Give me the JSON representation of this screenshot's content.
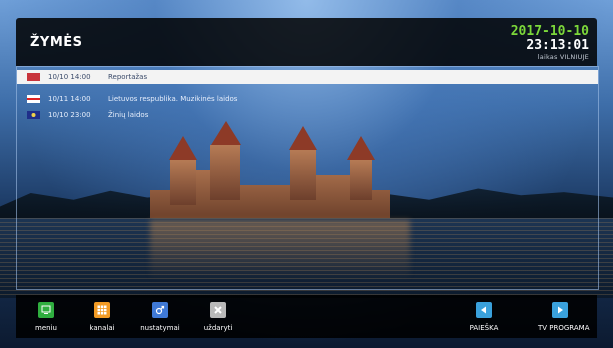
{
  "header": {
    "title": "ŽYMĖS"
  },
  "clock": {
    "date": "2017-10-10",
    "time": "23:13:01",
    "timezone": "laikas VILNIUJE"
  },
  "reminders": [
    {
      "flag": "flag-icon",
      "datetime": "10/10 14:00",
      "name": "Reportažas",
      "selected": true
    },
    {
      "flag": "flag-icon",
      "datetime": "10/11 14:00",
      "name": "Lietuvos respublika. Muzikinės laidos",
      "selected": false
    },
    {
      "flag": "flag-icon",
      "datetime": "10/10 23:00",
      "name": "Žinių laidos",
      "selected": false
    }
  ],
  "footer": {
    "menu": {
      "label": "meniu",
      "icon": "menu-icon",
      "color": "#2fae3f"
    },
    "channels": {
      "label": "kanalai",
      "icon": "grid-icon",
      "color": "#f29b25"
    },
    "settings": {
      "label": "nustatymai",
      "icon": "settings-icon",
      "color": "#3f79d6"
    },
    "close": {
      "label": "uždaryti",
      "icon": "close-icon",
      "color": "#b9b9b9"
    },
    "search": {
      "label": "PAIEŠKA",
      "icon": "arrow-left-icon",
      "color": "#3aa1dc"
    },
    "tvguide": {
      "label": "TV PROGRAMA",
      "icon": "arrow-right-icon",
      "color": "#3aa1dc"
    }
  }
}
